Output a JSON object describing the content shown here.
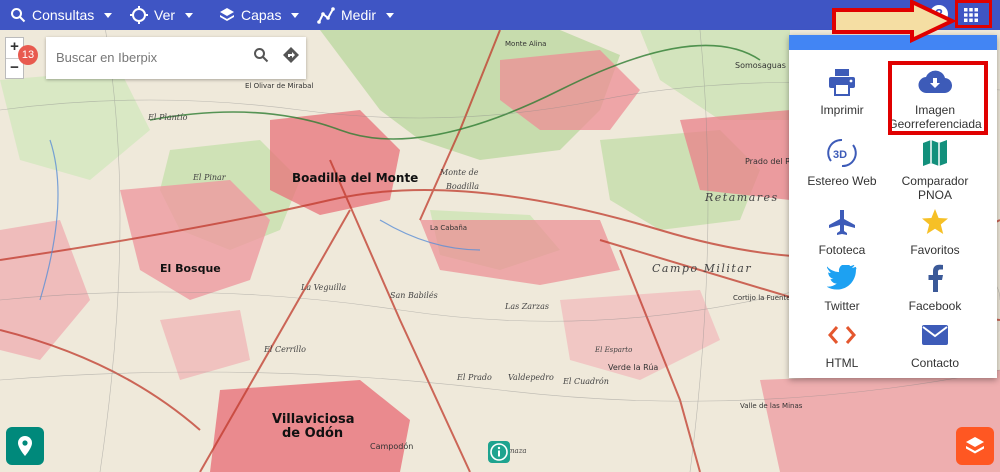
{
  "topbar": {
    "consultas": "Consultas",
    "ver": "Ver",
    "capas": "Capas",
    "medir": "Medir",
    "help": "?"
  },
  "zoom": {
    "in": "+",
    "out": "−"
  },
  "badge_count": "13",
  "search": {
    "placeholder": "Buscar en Iberpix"
  },
  "panel_items": [
    {
      "label": "Imprimir",
      "icon": "printer-icon"
    },
    {
      "label": "Imagen Georreferenciada",
      "icon": "cloud-download-icon"
    },
    {
      "label": "Estereo Web",
      "icon": "3d-icon"
    },
    {
      "label": "Comparador PNOA",
      "icon": "map-icon"
    },
    {
      "label": "Fototeca",
      "icon": "airplane-icon"
    },
    {
      "label": "Favoritos",
      "icon": "star-icon"
    },
    {
      "label": "Twitter",
      "icon": "twitter-icon"
    },
    {
      "label": "Facebook",
      "icon": "facebook-icon"
    },
    {
      "label": "HTML",
      "icon": "code-icon"
    },
    {
      "label": "Contacto",
      "icon": "mail-icon"
    }
  ],
  "map_labels": {
    "boadilla": "Boadilla del Monte",
    "el_bosque": "El Bosque",
    "villaviciosa_1": "Villaviciosa",
    "villaviciosa_2": "de Odón",
    "retamares": "Retamares",
    "campo_militar": "Campo Militar",
    "somosaguas": "Somosaguas",
    "monte_boadilla_1": "Monte de",
    "monte_boadilla_2": "Boadilla",
    "campodon": "Campodón",
    "prado_rey": "Prado del Rey",
    "el_plantio": "El Plantío",
    "la_cabaña": "La Cabaña",
    "el_olivar": "El Olivar de Mirabal",
    "monte_alina": "Monte Alina",
    "las_encinas": "El Pinar",
    "el_carrascal": "El Bosque",
    "la_veguilla": "La Veguilla",
    "el_cerrillo": "El Cerrillo",
    "el_prado": "El Prado",
    "la_sotillo": "San Babilés",
    "valdeproal": "Valdepedro",
    "la_zarzas": "Las Zarzas",
    "puerta_haya": "Verde la Rúa",
    "el_carrizo": "El Cuadrón",
    "el_esparto": "El Esparto",
    "las_lomas": "La Lomaza",
    "valle_minas": "Valle de las Minas",
    "castillejo": "Cortijo la Fuente"
  },
  "colors": {
    "topbar": "#3f55c4",
    "panel_band": "#4285f4",
    "highlight": "#e00000",
    "arrow_fill": "#f5dea3",
    "fab_location": "#00897b",
    "fab_layers": "#ff5722",
    "urban": "#e8727a",
    "forest": "#c7dcad"
  }
}
